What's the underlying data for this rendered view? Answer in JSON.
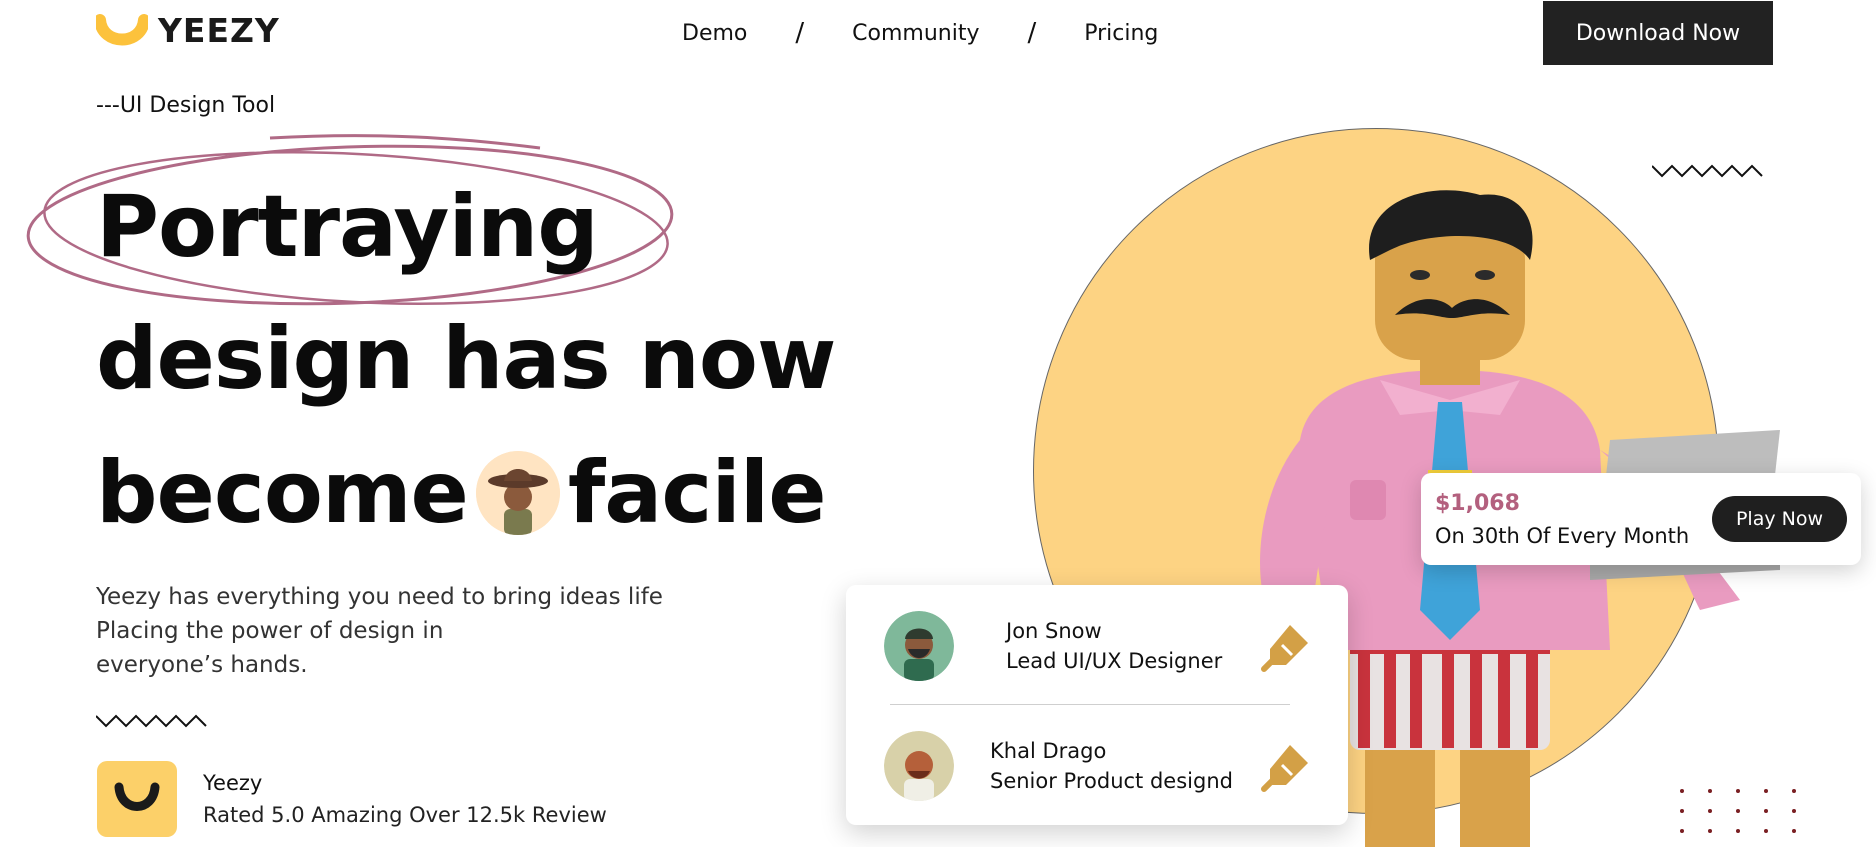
{
  "header": {
    "brand": "YEEZY",
    "nav": [
      "Demo",
      "Community",
      "Pricing"
    ],
    "nav_separator": "/",
    "cta": "Download Now"
  },
  "hero": {
    "tagline": "---UI Design Tool",
    "headline_line1": "Portraying",
    "headline_line2": "design has now",
    "headline_line3a": "become",
    "headline_line3b": "facile",
    "description_lines": [
      "Yeezy has everything you need to bring ideas life",
      "Placing the power of design in",
      "everyone’s hands."
    ]
  },
  "rating": {
    "title": "Yeezy",
    "subtitle": "Rated 5.0 Amazing Over 12.5k Review"
  },
  "pay_card": {
    "amount": "$1,068",
    "subtitle": "On 30th Of Every Month",
    "button": "Play Now"
  },
  "team": [
    {
      "name": "Jon Snow",
      "role": "Lead UI/UX Designer"
    },
    {
      "name": "Khal Drago",
      "role": "Senior Product designd"
    }
  ],
  "colors": {
    "accent_yellow": "#fdd383",
    "brand_yellow": "#fcd069",
    "amount_pink": "#b3607e",
    "scribble": "#b06a86",
    "dark": "#222222"
  }
}
